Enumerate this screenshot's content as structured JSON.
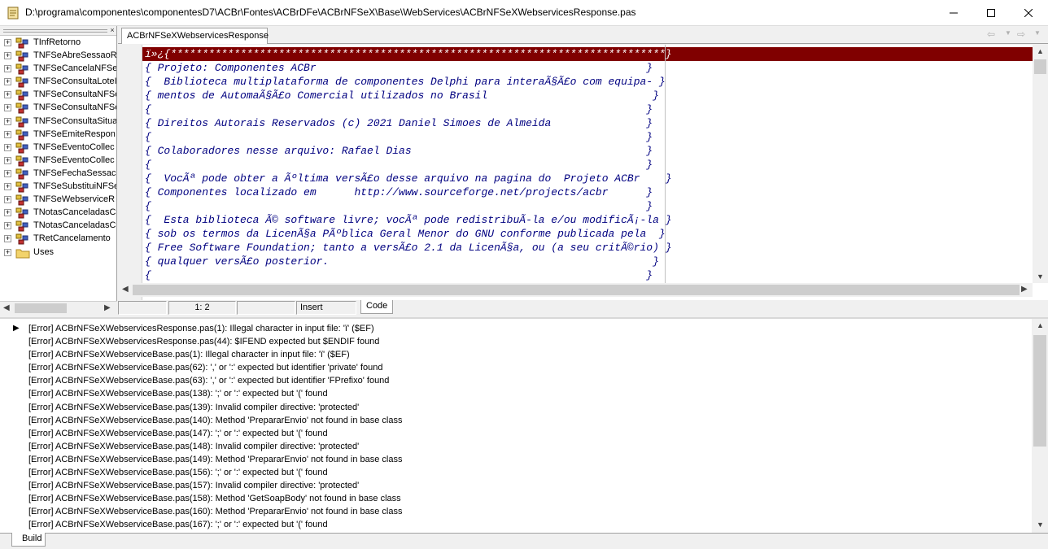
{
  "window": {
    "title": "D:\\programa\\componentes\\componentesD7\\ACBr\\Fontes\\ACBrDFe\\ACBrNFSeX\\Base\\WebServices\\ACBrNFSeXWebservicesResponse.pas",
    "minimize_icon": "minimize-icon",
    "maximize_icon": "maximize-icon",
    "close_icon": "close-icon"
  },
  "tree": {
    "close_glyph": "×",
    "expand_glyph": "+",
    "items": [
      {
        "label": "TInfRetorno",
        "icon": "class-icon"
      },
      {
        "label": "TNFSeAbreSessaoR",
        "icon": "class-icon"
      },
      {
        "label": "TNFSeCancelaNFSe",
        "icon": "class-icon"
      },
      {
        "label": "TNFSeConsultaLoteI",
        "icon": "class-icon"
      },
      {
        "label": "TNFSeConsultaNFSe",
        "icon": "class-icon"
      },
      {
        "label": "TNFSeConsultaNFSe",
        "icon": "class-icon"
      },
      {
        "label": "TNFSeConsultaSitua",
        "icon": "class-icon"
      },
      {
        "label": "TNFSeEmiteRespon",
        "icon": "class-icon"
      },
      {
        "label": "TNFSeEventoCollec",
        "icon": "class-icon"
      },
      {
        "label": "TNFSeEventoCollec",
        "icon": "class-icon"
      },
      {
        "label": "TNFSeFechaSessac",
        "icon": "class-icon"
      },
      {
        "label": "TNFSeSubstituiNFSe",
        "icon": "class-icon"
      },
      {
        "label": "TNFSeWebserviceR",
        "icon": "class-icon"
      },
      {
        "label": "TNotasCanceladasC",
        "icon": "class-icon"
      },
      {
        "label": "TNotasCanceladasC",
        "icon": "class-icon"
      },
      {
        "label": "TRetCancelamento",
        "icon": "class-icon"
      },
      {
        "label": "Uses",
        "icon": "folder-icon"
      }
    ]
  },
  "editor": {
    "tab_label": "ACBrNFSeXWebservicesResponse",
    "nav_back_glyph": "⇦",
    "nav_fwd_glyph": "⇨",
    "nav_dropdown_glyph": "▼",
    "lines": [
      "ï»¿{******************************************************************************}",
      "{ Projeto: Componentes ACBr                                                    }",
      "{  Biblioteca multiplataforma de componentes Delphi para interaÃ§Ã£o com equipa- }",
      "{ mentos de AutomaÃ§Ã£o Comercial utilizados no Brasil                          }",
      "{                                                                              }",
      "{ Direitos Autorais Reservados (c) 2021 Daniel Simoes de Almeida               }",
      "{                                                                              }",
      "{ Colaboradores nesse arquivo: Rafael Dias                                     }",
      "{                                                                              }",
      "{  VocÃª pode obter a Ãºltima versÃ£o desse arquivo na pagina do  Projeto ACBr    }",
      "{ Componentes localizado em      http://www.sourceforge.net/projects/acbr      }",
      "{                                                                              }",
      "{  Esta biblioteca Ã© software livre; vocÃª pode redistribuÃ­-la e/ou modificÃ¡-la }",
      "{ sob os termos da LicenÃ§a PÃºblica Geral Menor do GNU conforme publicada pela  }",
      "{ Free Software Foundation; tanto a versÃ£o 2.1 da LicenÃ§a, ou (a seu critÃ©rio) }",
      "{ qualquer versÃ£o posterior.                                                   }",
      "{                                                                              }"
    ]
  },
  "statusbar": {
    "position": "1:  2",
    "mode": "Insert",
    "view_tab": "Code"
  },
  "messages": {
    "current_marker": "▶",
    "items": [
      "[Error] ACBrNFSeXWebservicesResponse.pas(1): Illegal character in input file: 'ï' ($EF)",
      "[Error] ACBrNFSeXWebservicesResponse.pas(44): $IFEND expected but $ENDIF found",
      "[Error] ACBrNFSeXWebserviceBase.pas(1): Illegal character in input file: 'ï' ($EF)",
      "[Error] ACBrNFSeXWebserviceBase.pas(62): ',' or ':' expected but identifier 'private' found",
      "[Error] ACBrNFSeXWebserviceBase.pas(63): ',' or ':' expected but identifier 'FPrefixo' found",
      "[Error] ACBrNFSeXWebserviceBase.pas(138): ';' or ':' expected but '(' found",
      "[Error] ACBrNFSeXWebserviceBase.pas(139): Invalid compiler directive: 'protected'",
      "[Error] ACBrNFSeXWebserviceBase.pas(140): Method 'PrepararEnvio' not found in base class",
      "[Error] ACBrNFSeXWebserviceBase.pas(147): ';' or ':' expected but '(' found",
      "[Error] ACBrNFSeXWebserviceBase.pas(148): Invalid compiler directive: 'protected'",
      "[Error] ACBrNFSeXWebserviceBase.pas(149): Method 'PrepararEnvio' not found in base class",
      "[Error] ACBrNFSeXWebserviceBase.pas(156): ';' or ':' expected but '(' found",
      "[Error] ACBrNFSeXWebserviceBase.pas(157): Invalid compiler directive: 'protected'",
      "[Error] ACBrNFSeXWebserviceBase.pas(158): Method 'GetSoapBody' not found in base class",
      "[Error] ACBrNFSeXWebserviceBase.pas(160): Method 'PrepararEnvio' not found in base class",
      "[Error] ACBrNFSeXWebserviceBase.pas(167): ';' or ':' expected but '(' found"
    ]
  },
  "bottom_tabs": {
    "build_label": "Build"
  },
  "colors": {
    "current_line_bg": "#800000",
    "comment_text": "#000080"
  }
}
